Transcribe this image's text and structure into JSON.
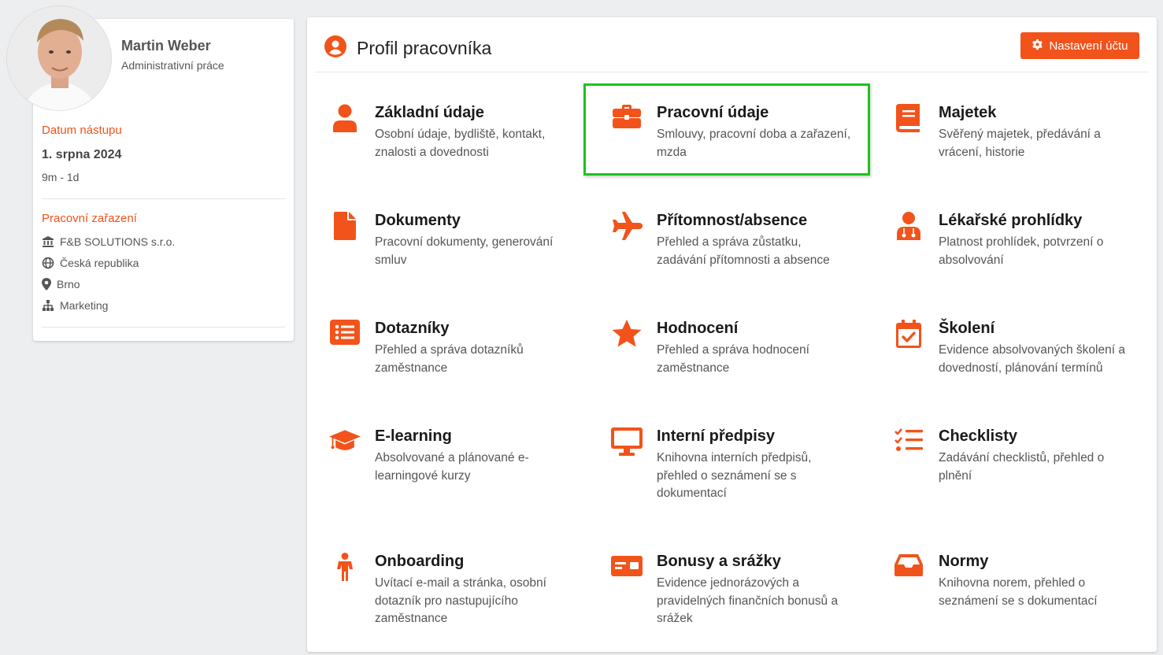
{
  "profile": {
    "name": "Martin Weber",
    "role": "Administrativní práce",
    "start_label": "Datum nástupu",
    "start_date": "1. srpna 2024",
    "tenure": "9m - 1d",
    "position_label": "Pracovní zařazení",
    "company": "F&B SOLUTIONS s.r.o.",
    "country": "Česká republika",
    "city": "Brno",
    "department": "Marketing"
  },
  "header": {
    "title": "Profil pracovníka",
    "settings_label": "Nastavení účtu"
  },
  "tiles": [
    {
      "title": "Základní údaje",
      "desc": "Osobní údaje, bydliště, kontakt, znalosti a dovednosti",
      "icon": "user-icon"
    },
    {
      "title": "Pracovní údaje",
      "desc": "Smlouvy, pracovní doba a zařazení, mzda",
      "icon": "briefcase-icon"
    },
    {
      "title": "Majetek",
      "desc": "Svěřený majetek, předávání a vrácení, historie",
      "icon": "book-icon"
    },
    {
      "title": "Dokumenty",
      "desc": "Pracovní dokumenty, generování smluv",
      "icon": "file-icon"
    },
    {
      "title": "Přítomnost/absence",
      "desc": "Přehled a správa zůstatku, zadávání přítomnosti a absence",
      "icon": "plane-icon"
    },
    {
      "title": "Lékařské prohlídky",
      "desc": "Platnost prohlídek, potvrzení o absolvování",
      "icon": "doctor-icon"
    },
    {
      "title": "Dotazníky",
      "desc": "Přehled a správa dotazníků zaměstnance",
      "icon": "list-icon"
    },
    {
      "title": "Hodnocení",
      "desc": "Přehled a správa hodnocení zaměstnance",
      "icon": "star-icon"
    },
    {
      "title": "Školení",
      "desc": "Evidence absolvovaných školení a dovedností, plánování termínů",
      "icon": "calendar-check-icon"
    },
    {
      "title": "E-learning",
      "desc": "Absolvované a plánované e-learningové kurzy",
      "icon": "graduation-cap-icon"
    },
    {
      "title": "Interní předpisy",
      "desc": "Knihovna interních předpisů, přehled o seznámení se s dokumentací",
      "icon": "monitor-icon"
    },
    {
      "title": "Checklisty",
      "desc": "Zadávání checklistů, přehled o plnění",
      "icon": "checklist-icon"
    },
    {
      "title": "Onboarding",
      "desc": "Uvítací e-mail a stránka, osobní dotazník pro nastupujícího zaměstnance",
      "icon": "person-icon"
    },
    {
      "title": "Bonusy a srážky",
      "desc": "Evidence jednorázových a pravidelných finančních bonusů a srážek",
      "icon": "money-card-icon"
    },
    {
      "title": "Normy",
      "desc": "Knihovna norem, přehled o seznámení se s dokumentací",
      "icon": "inbox-icon"
    }
  ],
  "colors": {
    "accent": "#f2531b",
    "highlight": "#1ec31e"
  }
}
